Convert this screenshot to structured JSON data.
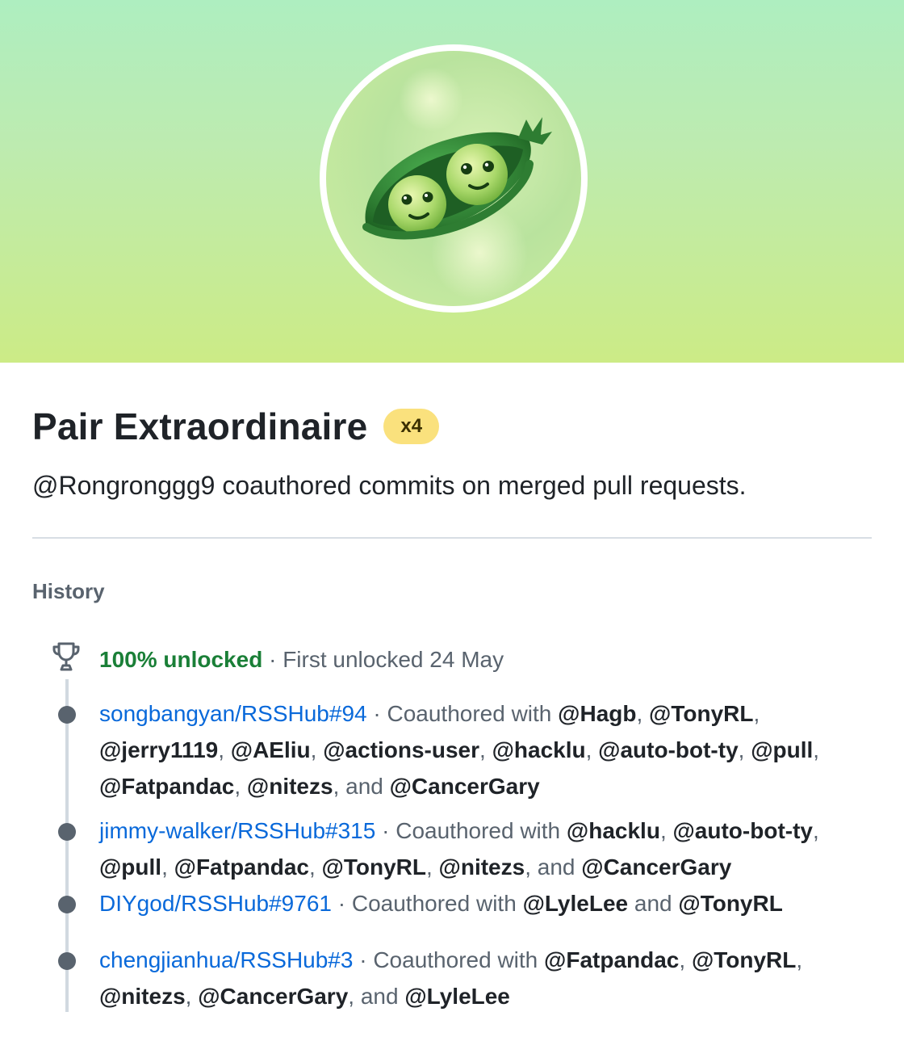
{
  "achievement": {
    "title": "Pair Extraordinaire",
    "count_label": "x4",
    "description": "@Rongronggg9 coauthored commits on merged pull requests.",
    "icon": "pea-pod-icon"
  },
  "history": {
    "heading": "History",
    "unlock_status": "100% unlocked",
    "unlock_separator": " · ",
    "first_unlocked": "First unlocked 24 May",
    "icon": "trophy-icon",
    "entries": [
      {
        "pr": "songbangyan/RSSHub#94",
        "prefix": " · Coauthored with ",
        "users": [
          "@Hagb",
          "@TonyRL",
          "@jerry1119",
          "@AEliu",
          "@actions-user",
          "@hacklu",
          "@auto-bot-ty",
          "@pull",
          "@Fatpandac",
          "@nitezs",
          "@CancerGary"
        ]
      },
      {
        "pr": "jimmy-walker/RSSHub#315",
        "prefix": " · Coauthored with ",
        "users": [
          "@hacklu",
          "@auto-bot-ty",
          "@pull",
          "@Fatpandac",
          "@TonyRL",
          "@nitezs",
          "@CancerGary"
        ]
      },
      {
        "pr": "DIYgod/RSSHub#9761",
        "prefix": " · Coauthored with ",
        "users": [
          "@LyleLee",
          "@TonyRL"
        ]
      },
      {
        "pr": "chengjianhua/RSSHub#3",
        "prefix": " · Coauthored with ",
        "users": [
          "@Fatpandac",
          "@TonyRL",
          "@nitezs",
          "@CancerGary",
          "@LyleLee"
        ]
      }
    ],
    "list_separator": ", ",
    "list_last_separator": ", and ",
    "pair_separator": " and "
  },
  "colors": {
    "link": "#0969da",
    "success": "#1a7f37",
    "badge_pill": "#fae17d",
    "hero_top": "#aeeec0",
    "hero_bottom": "#cceb86"
  }
}
